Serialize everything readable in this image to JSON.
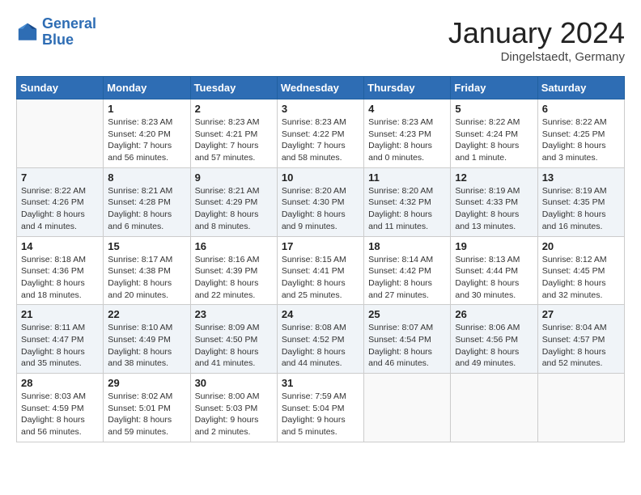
{
  "logo": {
    "line1": "General",
    "line2": "Blue"
  },
  "title": "January 2024",
  "location": "Dingelstaedt, Germany",
  "weekdays": [
    "Sunday",
    "Monday",
    "Tuesday",
    "Wednesday",
    "Thursday",
    "Friday",
    "Saturday"
  ],
  "weeks": [
    [
      {
        "day": "",
        "info": ""
      },
      {
        "day": "1",
        "info": "Sunrise: 8:23 AM\nSunset: 4:20 PM\nDaylight: 7 hours\nand 56 minutes."
      },
      {
        "day": "2",
        "info": "Sunrise: 8:23 AM\nSunset: 4:21 PM\nDaylight: 7 hours\nand 57 minutes."
      },
      {
        "day": "3",
        "info": "Sunrise: 8:23 AM\nSunset: 4:22 PM\nDaylight: 7 hours\nand 58 minutes."
      },
      {
        "day": "4",
        "info": "Sunrise: 8:23 AM\nSunset: 4:23 PM\nDaylight: 8 hours\nand 0 minutes."
      },
      {
        "day": "5",
        "info": "Sunrise: 8:22 AM\nSunset: 4:24 PM\nDaylight: 8 hours\nand 1 minute."
      },
      {
        "day": "6",
        "info": "Sunrise: 8:22 AM\nSunset: 4:25 PM\nDaylight: 8 hours\nand 3 minutes."
      }
    ],
    [
      {
        "day": "7",
        "info": "Sunrise: 8:22 AM\nSunset: 4:26 PM\nDaylight: 8 hours\nand 4 minutes."
      },
      {
        "day": "8",
        "info": "Sunrise: 8:21 AM\nSunset: 4:28 PM\nDaylight: 8 hours\nand 6 minutes."
      },
      {
        "day": "9",
        "info": "Sunrise: 8:21 AM\nSunset: 4:29 PM\nDaylight: 8 hours\nand 8 minutes."
      },
      {
        "day": "10",
        "info": "Sunrise: 8:20 AM\nSunset: 4:30 PM\nDaylight: 8 hours\nand 9 minutes."
      },
      {
        "day": "11",
        "info": "Sunrise: 8:20 AM\nSunset: 4:32 PM\nDaylight: 8 hours\nand 11 minutes."
      },
      {
        "day": "12",
        "info": "Sunrise: 8:19 AM\nSunset: 4:33 PM\nDaylight: 8 hours\nand 13 minutes."
      },
      {
        "day": "13",
        "info": "Sunrise: 8:19 AM\nSunset: 4:35 PM\nDaylight: 8 hours\nand 16 minutes."
      }
    ],
    [
      {
        "day": "14",
        "info": "Sunrise: 8:18 AM\nSunset: 4:36 PM\nDaylight: 8 hours\nand 18 minutes."
      },
      {
        "day": "15",
        "info": "Sunrise: 8:17 AM\nSunset: 4:38 PM\nDaylight: 8 hours\nand 20 minutes."
      },
      {
        "day": "16",
        "info": "Sunrise: 8:16 AM\nSunset: 4:39 PM\nDaylight: 8 hours\nand 22 minutes."
      },
      {
        "day": "17",
        "info": "Sunrise: 8:15 AM\nSunset: 4:41 PM\nDaylight: 8 hours\nand 25 minutes."
      },
      {
        "day": "18",
        "info": "Sunrise: 8:14 AM\nSunset: 4:42 PM\nDaylight: 8 hours\nand 27 minutes."
      },
      {
        "day": "19",
        "info": "Sunrise: 8:13 AM\nSunset: 4:44 PM\nDaylight: 8 hours\nand 30 minutes."
      },
      {
        "day": "20",
        "info": "Sunrise: 8:12 AM\nSunset: 4:45 PM\nDaylight: 8 hours\nand 32 minutes."
      }
    ],
    [
      {
        "day": "21",
        "info": "Sunrise: 8:11 AM\nSunset: 4:47 PM\nDaylight: 8 hours\nand 35 minutes."
      },
      {
        "day": "22",
        "info": "Sunrise: 8:10 AM\nSunset: 4:49 PM\nDaylight: 8 hours\nand 38 minutes."
      },
      {
        "day": "23",
        "info": "Sunrise: 8:09 AM\nSunset: 4:50 PM\nDaylight: 8 hours\nand 41 minutes."
      },
      {
        "day": "24",
        "info": "Sunrise: 8:08 AM\nSunset: 4:52 PM\nDaylight: 8 hours\nand 44 minutes."
      },
      {
        "day": "25",
        "info": "Sunrise: 8:07 AM\nSunset: 4:54 PM\nDaylight: 8 hours\nand 46 minutes."
      },
      {
        "day": "26",
        "info": "Sunrise: 8:06 AM\nSunset: 4:56 PM\nDaylight: 8 hours\nand 49 minutes."
      },
      {
        "day": "27",
        "info": "Sunrise: 8:04 AM\nSunset: 4:57 PM\nDaylight: 8 hours\nand 52 minutes."
      }
    ],
    [
      {
        "day": "28",
        "info": "Sunrise: 8:03 AM\nSunset: 4:59 PM\nDaylight: 8 hours\nand 56 minutes."
      },
      {
        "day": "29",
        "info": "Sunrise: 8:02 AM\nSunset: 5:01 PM\nDaylight: 8 hours\nand 59 minutes."
      },
      {
        "day": "30",
        "info": "Sunrise: 8:00 AM\nSunset: 5:03 PM\nDaylight: 9 hours\nand 2 minutes."
      },
      {
        "day": "31",
        "info": "Sunrise: 7:59 AM\nSunset: 5:04 PM\nDaylight: 9 hours\nand 5 minutes."
      },
      {
        "day": "",
        "info": ""
      },
      {
        "day": "",
        "info": ""
      },
      {
        "day": "",
        "info": ""
      }
    ]
  ]
}
